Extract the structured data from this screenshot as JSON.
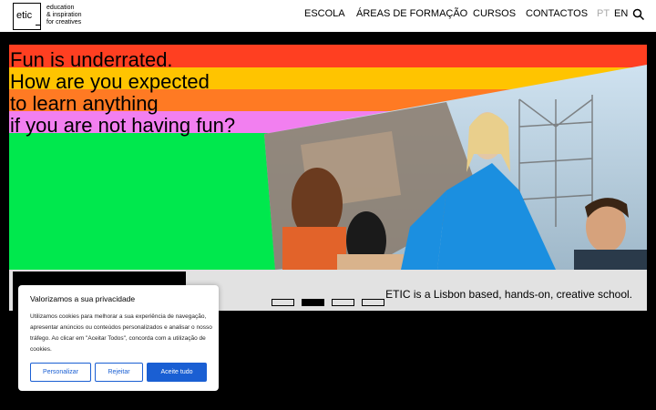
{
  "header": {
    "logo_text": "etic_",
    "tagline": [
      "education",
      "& inspiration",
      "for creatives"
    ],
    "nav": [
      "ESCOLA",
      "ÁREAS DE FORMAÇÃO",
      "CURSOS",
      "CONTACTOS"
    ],
    "lang_pt": "PT",
    "lang_en": "EN"
  },
  "hero": {
    "headline": [
      "Fun is underrated.",
      "How are you expected",
      "to learn anything",
      "if you are not having fun?"
    ],
    "caption": "ETIC is a Lisbon based, hands-on, creative school.",
    "slides": 4,
    "active_slide": 2
  },
  "cookie": {
    "title": "Valorizamos a sua privacidade",
    "text": "Utilizamos cookies para melhorar a sua experiência de navegação, apresentar anúncios ou conteúdos personalizados e analisar o nosso tráfego. Ao clicar em \"Aceitar Todos\", concorda com a utilização de cookies.",
    "customize": "Personalizar",
    "reject": "Rejeitar",
    "accept": "Aceite tudo"
  },
  "colors": {
    "red": "#ff3f21",
    "yellow": "#ffc400",
    "orange": "#ff7a23",
    "pink": "#f27ff0",
    "green": "#00e84d",
    "accent_blue": "#1a5fd3"
  }
}
